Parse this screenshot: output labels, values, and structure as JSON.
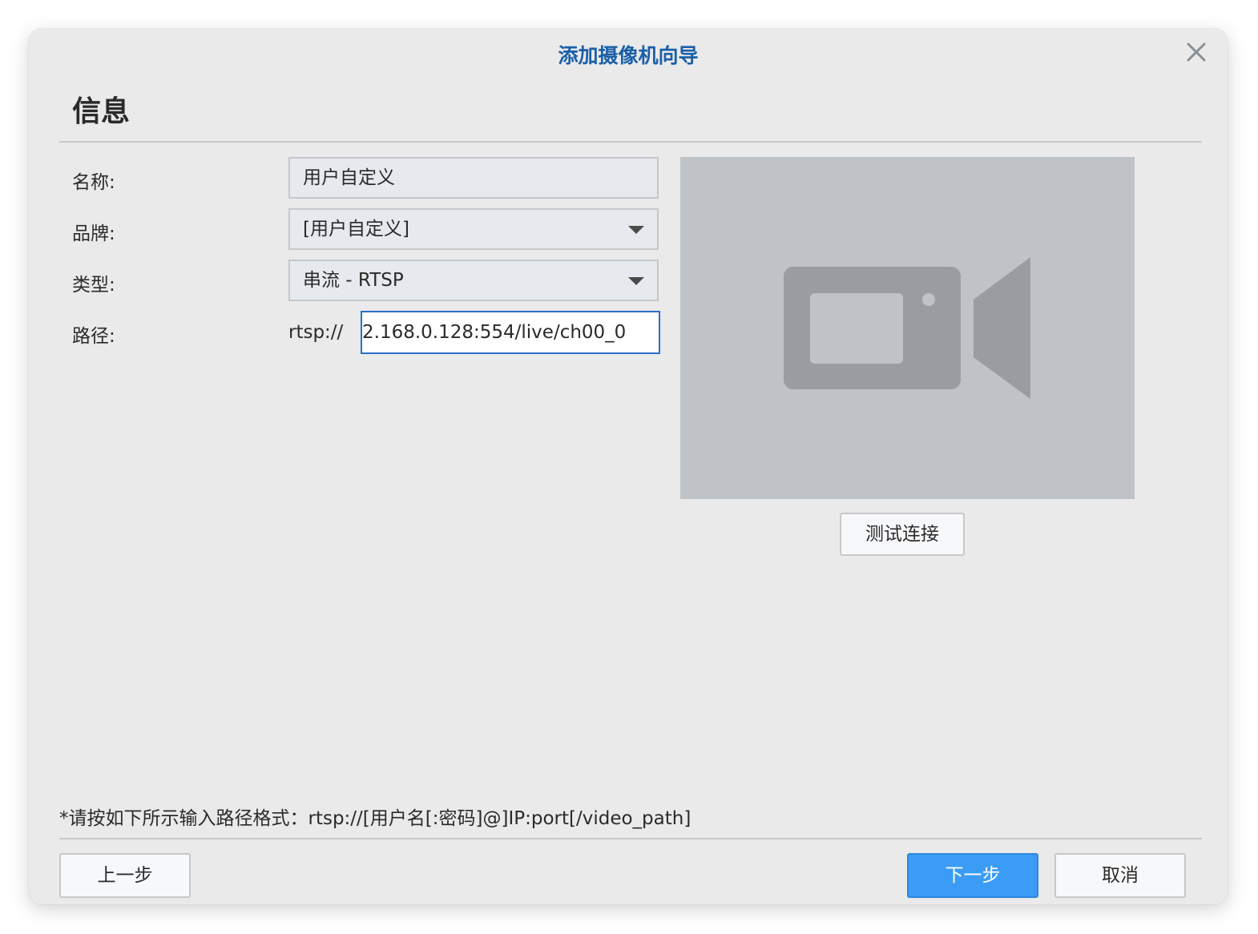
{
  "dialog": {
    "title": "添加摄像机向导",
    "section_title": "信息"
  },
  "form": {
    "name_label": "名称:",
    "name_value": "用户自定义",
    "brand_label": "品牌:",
    "brand_value": "[用户自定义]",
    "type_label": "类型:",
    "type_value": "串流 - RTSP",
    "path_label": "路径:",
    "path_prefix": "rtsp://",
    "path_value": "2.168.0.128:554/live/ch00_0"
  },
  "preview": {
    "icon": "video-camera-icon",
    "test_button": "测试连接"
  },
  "hint": "*请按如下所示输入路径格式：rtsp://[用户名[:密码]@]IP:port[/video_path]",
  "footer": {
    "back_button": "上一步",
    "next_button": "下一步",
    "cancel_button": "取消"
  },
  "colors": {
    "title": "#1a5fa8",
    "primary_button": "#3b9cf6",
    "focus_border": "#2a6fc9"
  }
}
